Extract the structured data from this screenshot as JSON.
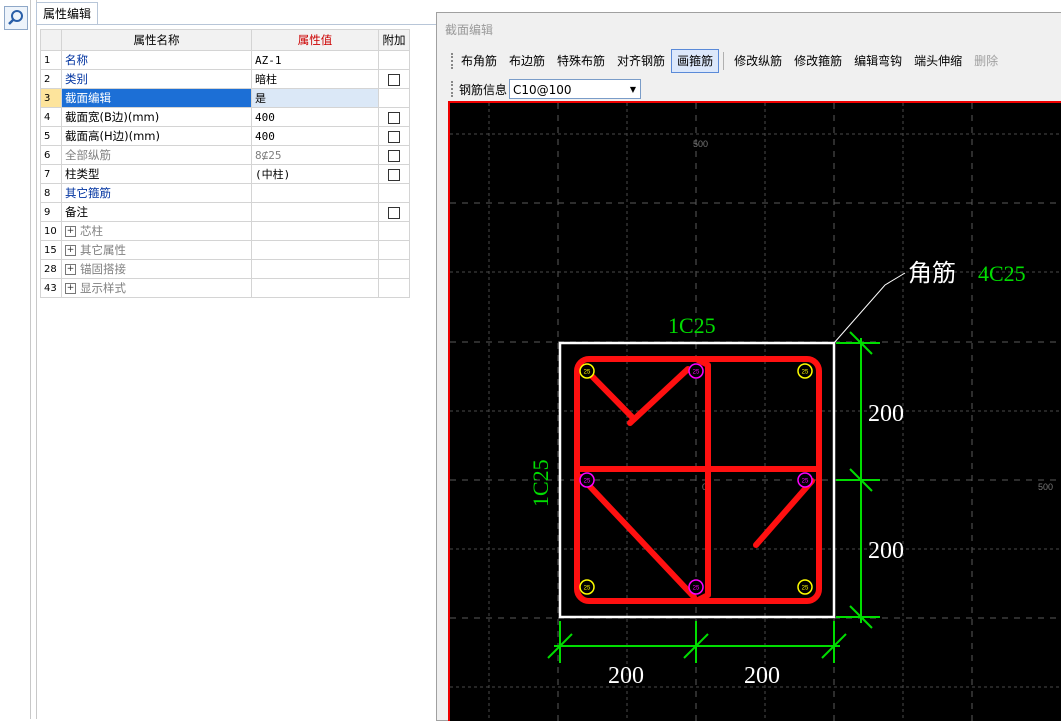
{
  "panel": {
    "tab_label": "属性编辑",
    "headers": {
      "num": "",
      "name": "属性名称",
      "value": "属性值",
      "extra": "附加"
    },
    "rows": [
      {
        "num": "1",
        "name": "名称",
        "value": "AZ-1",
        "style": "blue",
        "check": false
      },
      {
        "num": "2",
        "name": "类别",
        "value": "暗柱",
        "style": "blue",
        "check": true
      },
      {
        "num": "3",
        "name": "截面编辑",
        "value": "是",
        "style": "sel",
        "check": false
      },
      {
        "num": "4",
        "name": "截面宽(B边)(mm)",
        "value": "400",
        "style": "",
        "check": true
      },
      {
        "num": "5",
        "name": "截面高(H边)(mm)",
        "value": "400",
        "style": "",
        "check": true
      },
      {
        "num": "6",
        "name": "全部纵筋",
        "value": "8⊈25",
        "style": "gray",
        "check": true
      },
      {
        "num": "7",
        "name": "柱类型",
        "value": "(中柱)",
        "style": "",
        "check": true
      },
      {
        "num": "8",
        "name": "其它箍筋",
        "value": "",
        "style": "blue",
        "check": false
      },
      {
        "num": "9",
        "name": "备注",
        "value": "",
        "style": "",
        "check": true
      },
      {
        "num": "10",
        "name": "芯柱",
        "value": "",
        "style": "gray",
        "check": false,
        "group": true
      },
      {
        "num": "15",
        "name": "其它属性",
        "value": "",
        "style": "gray",
        "check": false,
        "group": true
      },
      {
        "num": "28",
        "name": "锚固搭接",
        "value": "",
        "style": "gray",
        "check": false,
        "group": true
      },
      {
        "num": "43",
        "name": "显示样式",
        "value": "",
        "style": "gray",
        "check": false,
        "group": true
      }
    ]
  },
  "editor": {
    "title": "截面编辑",
    "toolbar": [
      {
        "label": "布角筋",
        "state": "normal"
      },
      {
        "label": "布边筋",
        "state": "normal"
      },
      {
        "label": "特殊布筋",
        "state": "normal"
      },
      {
        "label": "对齐钢筋",
        "state": "normal"
      },
      {
        "label": "画箍筋",
        "state": "active"
      },
      {
        "label": "修改纵筋",
        "state": "normal"
      },
      {
        "label": "修改箍筋",
        "state": "normal"
      },
      {
        "label": "编辑弯钩",
        "state": "normal"
      },
      {
        "label": "端头伸缩",
        "state": "normal"
      },
      {
        "label": "删除",
        "state": "disabled"
      }
    ],
    "rebar_info_label": "钢筋信息",
    "rebar_info_value": "C10@100"
  },
  "drawing": {
    "grid_label_top": "500",
    "grid_label_right": "500",
    "center_mark": "0",
    "corner_label": "角筋",
    "corner_value": "4C25",
    "top_label": "1C25",
    "left_label": "1C25",
    "dim_right_1": "200",
    "dim_right_2": "200",
    "dim_bottom_1": "200",
    "dim_bottom_2": "200",
    "bar_size": "25",
    "colors": {
      "frame": "#ffffff",
      "stirrup": "#ff0000",
      "dimension": "#00dd00",
      "corner_bar": "#ffff00",
      "side_bar": "#ff00ff"
    }
  }
}
